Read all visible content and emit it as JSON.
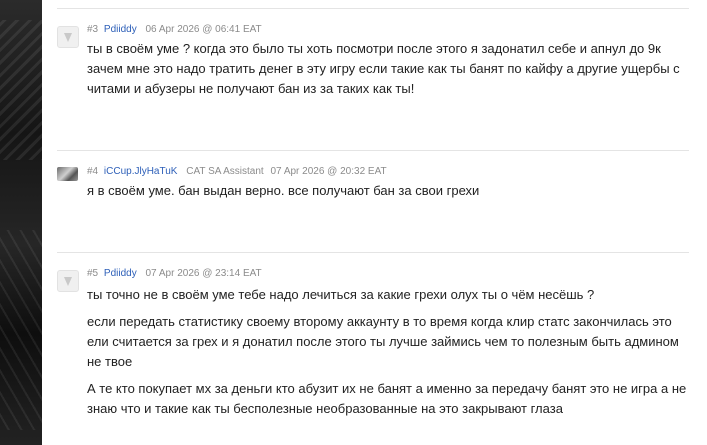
{
  "posts": [
    {
      "number": "#3",
      "author": "Pdiiddy",
      "role": "",
      "date": "06 Apr 2026 @ 06:41 EAT",
      "paragraphs": [
        "ты в своём уме ? когда это было ты хоть посмотри после этого я задонатил себе и апнул до 9к зачем мне это надо тратить денег в эту игру если такие как ты банят по кайфу а другие ущербы с читами и абузеры не получают бан из за таких как ты!"
      ]
    },
    {
      "number": "#4",
      "author": "iCCup.JlyHaTuK",
      "role": "CAT SA Assistant",
      "date": "07 Apr 2026 @ 20:32 EAT",
      "paragraphs": [
        "я в своём уме. бан выдан верно. все получают бан за свои грехи"
      ]
    },
    {
      "number": "#5",
      "author": "Pdiiddy",
      "role": "",
      "date": "07 Apr 2026 @ 23:14 EAT",
      "paragraphs": [
        "ты точно не в своём уме тебе надо лечиться за какие грехи олух ты о чём несёшь ?",
        "если передать статистику своему второму аккаунту в то время когда клир статс закончилась это ели считается за грех и я донатил после этого ты лучше займись чем то полезным быть админом не твое",
        "А те кто покупает мх за деньги кто абузит их не банят а именно за передачу банят это не игра а не знаю что и такие как ты бесполезные необразованные на это закрывают глаза"
      ]
    }
  ]
}
